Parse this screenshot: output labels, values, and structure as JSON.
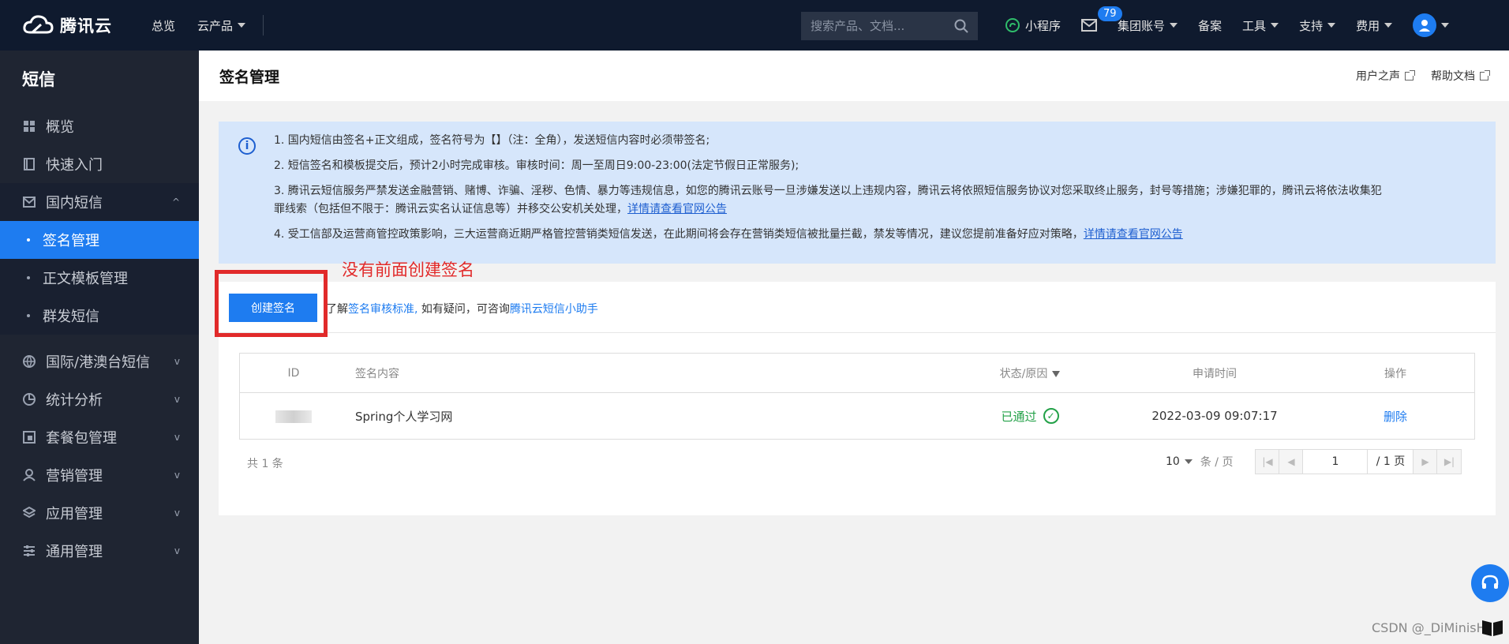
{
  "topbar": {
    "brand": "腾讯云",
    "nav": [
      "总览",
      "云产品"
    ],
    "search_placeholder": "搜索产品、文档...",
    "right": [
      "小程序",
      "集团账号",
      "备案",
      "工具",
      "支持",
      "费用"
    ],
    "message_badge": "79"
  },
  "sidebar": {
    "title": "短信",
    "items": [
      {
        "label": "概览",
        "icon": "dashboard-icon"
      },
      {
        "label": "快速入门",
        "icon": "book-icon"
      },
      {
        "label": "国内短信",
        "icon": "mail-icon"
      },
      {
        "label": "签名管理"
      },
      {
        "label": "正文模板管理"
      },
      {
        "label": "群发短信"
      },
      {
        "label": "国际/港澳台短信",
        "icon": "globe-icon"
      },
      {
        "label": "统计分析",
        "icon": "pie-chart-icon"
      },
      {
        "label": "套餐包管理",
        "icon": "package-icon"
      },
      {
        "label": "营销管理",
        "icon": "user-icon"
      },
      {
        "label": "应用管理",
        "icon": "layers-icon"
      },
      {
        "label": "通用管理",
        "icon": "sliders-icon"
      }
    ]
  },
  "header": {
    "title": "签名管理",
    "links": [
      "用户之声",
      "帮助文档"
    ]
  },
  "notice": {
    "lines": [
      "1. 国内短信由签名+正文组成，签名符号为【】（注：全角），发送短信内容时必须带签名;",
      "2. 短信签名和模板提交后，预计2小时完成审核。审核时间：周一至周日9:00-23:00(法定节假日正常服务);",
      "3. 腾讯云短信服务严禁发送金融营销、赌博、诈骗、淫秽、色情、暴力等违规信息，如您的腾讯云账号一旦涉嫌发送以上违规内容，腾讯云将依照短信服务协议对您采取终止服务，封号等措施；涉嫌犯罪的，腾讯云将依法收集犯",
      "罪线索（包括但不限于：腾讯云实名认证信息等）并移交公安机关处理，",
      "4. 受工信部及运营商管控政策影响，三大运营商近期严格管控营销类短信发送，在此期间将会存在营销类短信被批量拦截，禁发等情况，建议您提前准备好应对策略，"
    ],
    "link_text": "详情请查看官网公告"
  },
  "panel": {
    "create_button": "创建签名",
    "hint_prefix": "了解",
    "hint_link1": "签名审核标准,",
    "hint_mid": " 如有疑问，可咨询",
    "hint_link2": "腾讯云短信小助手"
  },
  "table": {
    "columns": [
      "ID",
      "签名内容",
      "状态/原因",
      "申请时间",
      "操作"
    ],
    "rows": [
      {
        "content": "Spring个人学习网",
        "status": "已通过",
        "time": "2022-03-09 09:07:17",
        "action": "删除"
      }
    ]
  },
  "footer": {
    "total": "共 1 条",
    "page_size": "10",
    "per_page": "条 / 页",
    "page": "1",
    "total_pages": "/ 1 页"
  },
  "annotation": "没有前面创建签名",
  "watermark": "CSDN @_DiMinisH"
}
